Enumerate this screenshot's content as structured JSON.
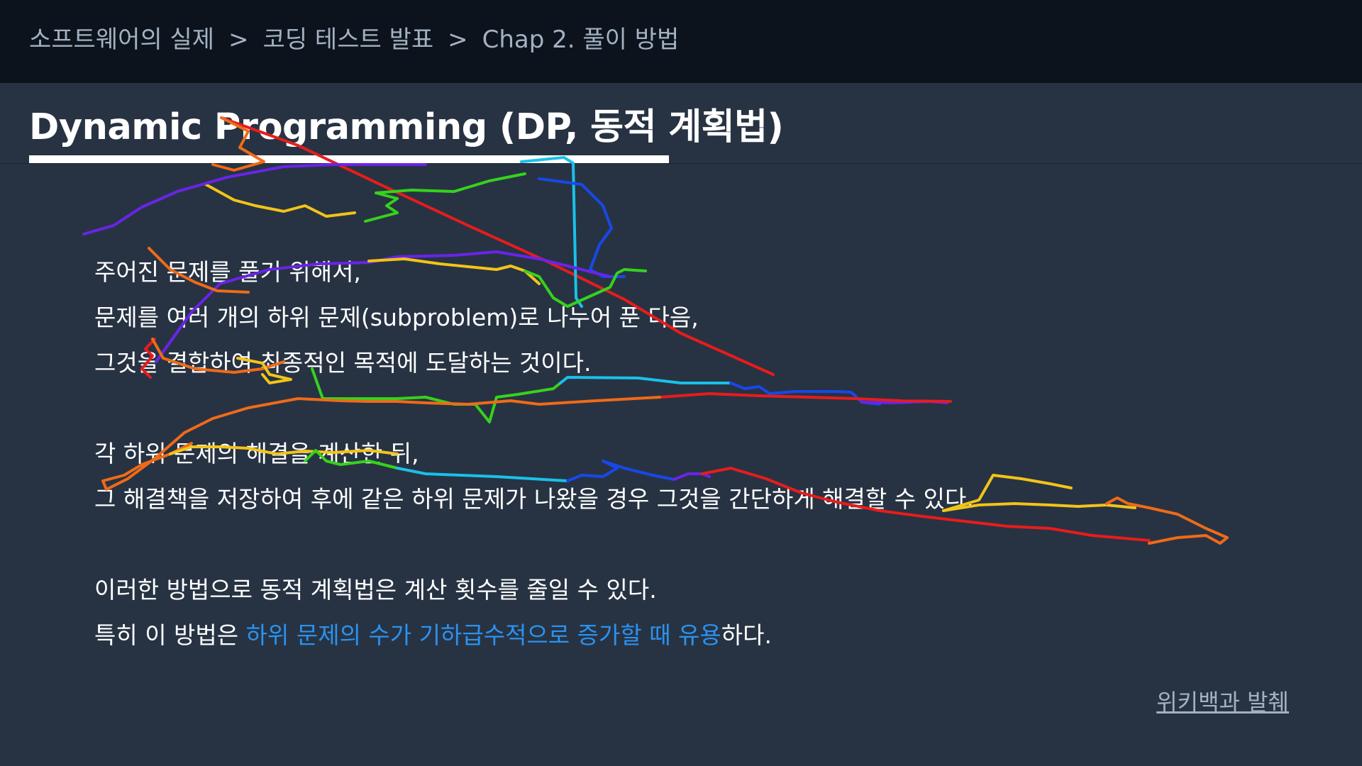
{
  "breadcrumb": {
    "items": [
      "소프트웨어의 실제",
      "코딩 테스트 발표",
      "Chap 2. 풀이 방법"
    ],
    "separator": ">"
  },
  "title": "Dynamic Programming (DP, 동적 계획법)",
  "body": {
    "p1": "주어진 문제를 풀기 위해서,",
    "p2": "문제를 여러 개의 하위 문제(subproblem)로 나누어 푼 다음,",
    "p3": "그것을 결합하여 최종적인 목적에 도달하는 것이다.",
    "p4": "각 하위 문제의 해결을 계산한 뒤,",
    "p5": "그 해결책을 저장하여 후에 같은 하위 문제가 나왔을 경우 그것을 간단하게 해결할 수 있다.",
    "p6": "이러한 방법으로 동적 계획법은 계산 횟수를 줄일 수 있다.",
    "p7_prefix": "특히 이 방법은 ",
    "p7_highlight": "하위 문제의 수가 기하급수적으로 증가할 때 유용",
    "p7_suffix": "하다."
  },
  "source_link": "위키백과 발췌",
  "colors": {
    "topbar": "#0c131c",
    "background": "#273343",
    "breadcrumb_text": "#a3b1c2",
    "highlight": "#2b92f0"
  }
}
